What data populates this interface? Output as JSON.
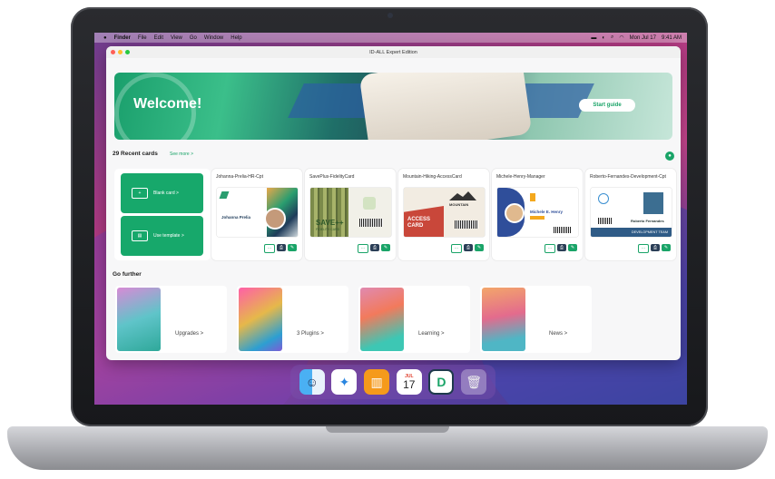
{
  "menubar": {
    "apple": "",
    "app": "Finder",
    "items": [
      "File",
      "Edit",
      "View",
      "Go",
      "Window",
      "Help"
    ],
    "date": "Mon Jul 17",
    "time": "9:41 AM"
  },
  "window": {
    "title": "ID-ALL Expert Edition",
    "hero": {
      "welcome": "Welcome!",
      "start_guide": "Start guide"
    },
    "recent": {
      "title": "29 Recent cards",
      "see_more": "See more >",
      "blank_card": "Blank card >",
      "use_template": "Use template >",
      "cards": [
        {
          "name": "Johanna-Prelia-HR-Cpt",
          "person": "Johanna Prelia"
        },
        {
          "name": "SavePlus-FidelityCard",
          "headline": "SAVE++",
          "sub": "FIDELITY CARD"
        },
        {
          "name": "Mountain-Hiking-AccessCard",
          "headline": "ACCESS CARD",
          "brand": "MOUNTAIN"
        },
        {
          "name": "Michele-Henry-Manager",
          "person": "Michele E. Henry"
        },
        {
          "name": "Roberto-Fernandes-Development-Cpt",
          "person": "Roberto Fernandes",
          "team": "DEVELOPMENT TEAM"
        }
      ],
      "actions": {
        "more": "···",
        "print": "⎙",
        "edit": "✎"
      }
    },
    "further": {
      "title": "Go further",
      "items": [
        "Upgrades >",
        "3 Plugins >",
        "Learning >",
        "News >"
      ]
    }
  },
  "dock": {
    "apps": [
      "finder-icon",
      "safari-icon",
      "books-icon",
      "calendar-icon",
      "id-all-icon",
      "trash-icon"
    ],
    "calendar_month": "JUL",
    "calendar_day": "17"
  },
  "colors": {
    "accent": "#17a86b",
    "dark": "#2b3f57"
  }
}
